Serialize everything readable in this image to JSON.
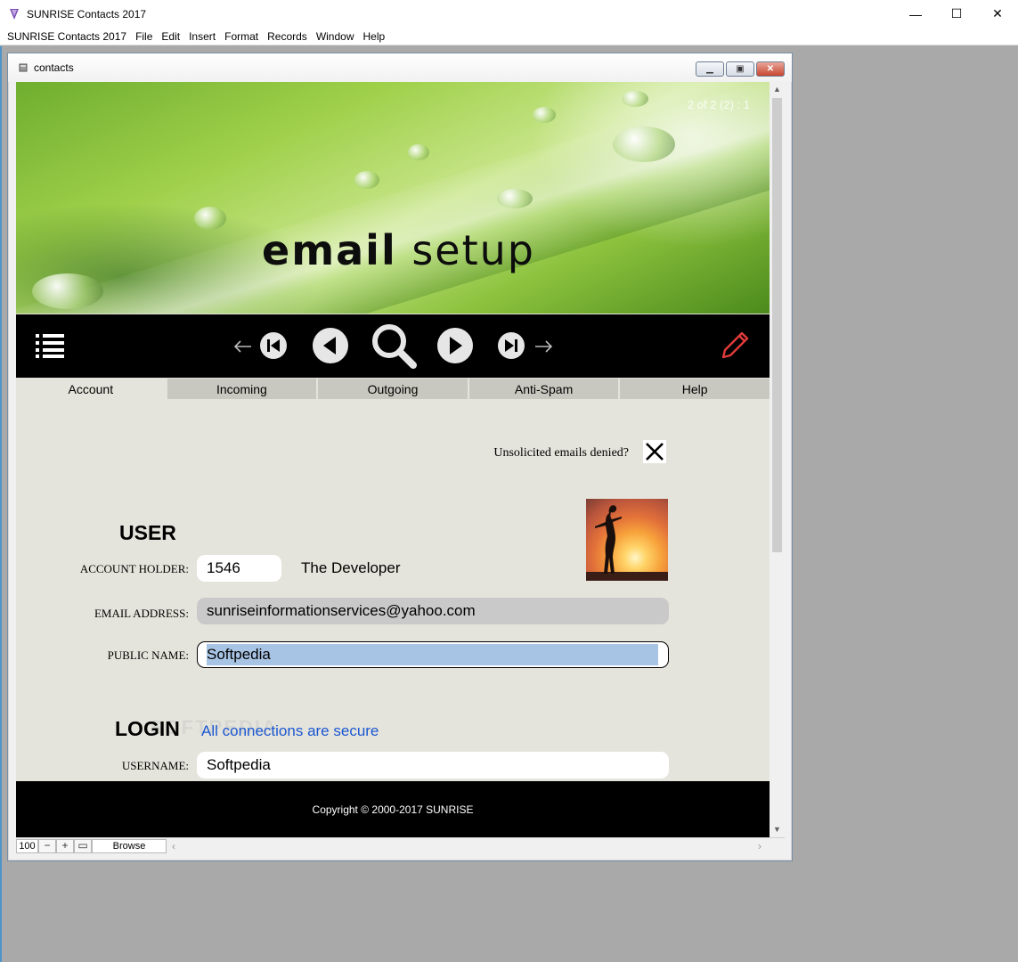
{
  "app": {
    "title": "SUNRISE Contacts 2017"
  },
  "window_controls": {
    "minimize": "—",
    "maximize": "☐",
    "close": "✕"
  },
  "menu": [
    "SUNRISE Contacts 2017",
    "File",
    "Edit",
    "Insert",
    "Format",
    "Records",
    "Window",
    "Help"
  ],
  "child_window": {
    "title": "contacts"
  },
  "header": {
    "counter": "2 of 2 (2) : 1",
    "title_bold": "email",
    "title_rest": "setup"
  },
  "tabs": [
    "Account",
    "Incoming",
    "Outgoing",
    "Anti-Spam",
    "Help"
  ],
  "active_tab": "Account",
  "form": {
    "unsolicited_label": "Unsolicited emails denied?",
    "unsolicited_checked": true,
    "user_heading": "USER",
    "account_holder_label": "ACCOUNT HOLDER:",
    "account_holder_id": "1546",
    "account_holder_name": "The Developer",
    "email_label": "EMAIL ADDRESS:",
    "email_value": "sunriseinformationservices@yahoo.com",
    "public_name_label": "PUBLIC NAME:",
    "public_name_value": "Softpedia",
    "login_heading": "LOGIN",
    "secure_note": "All connections are secure",
    "username_label": "USERNAME:",
    "username_value": "Softpedia"
  },
  "footer": {
    "copyright": "Copyright © 2000-2017 SUNRISE"
  },
  "statusbar": {
    "zoom": "100",
    "mode": "Browse"
  },
  "colors": {
    "accent_link": "#1a57d1",
    "nav_bg": "#000000",
    "edit_icon": "#e23b3b",
    "selection": "#a8c4e4"
  }
}
